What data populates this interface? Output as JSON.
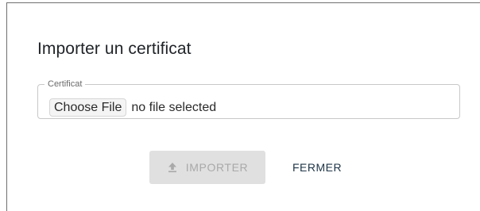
{
  "dialog": {
    "title": "Importer un certificat",
    "certificate_field": {
      "legend": "Certificat",
      "choose_button_label": "Choose File",
      "status_text": "no file selected"
    },
    "actions": {
      "import_label": "IMPORTER",
      "import_icon": "upload-icon",
      "import_disabled": true,
      "close_label": "FERMER"
    }
  },
  "colors": {
    "title_text": "#1f2327",
    "disabled_button_bg": "#e0e0e0",
    "disabled_button_text": "#a9a9a9",
    "close_button_text": "#1e3446",
    "field_border": "#c8c8c8"
  }
}
